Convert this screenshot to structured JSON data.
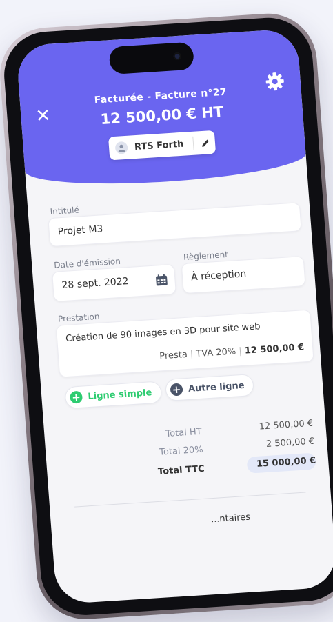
{
  "header": {
    "status_title": "Facturée - Facture n°27",
    "amount": "12 500,00 € HT",
    "client_name": "RTS Forth",
    "accent_color": "#6a65f0"
  },
  "form": {
    "intitule_label": "Intitulé",
    "intitule_value": "Projet M3",
    "date_label": "Date d'émission",
    "date_value": "28 sept. 2022",
    "reglement_label": "Règlement",
    "reglement_value": "À réception",
    "prestation_label": "Prestation",
    "prestation_desc": "Création de 90 images en 3D pour site web",
    "prestation_type": "Presta",
    "prestation_tva": "TVA 20%",
    "prestation_amount": "12 500,00 €"
  },
  "actions": {
    "simple_line": "Ligne simple",
    "other_line": "Autre ligne",
    "simple_color": "#2ecc71",
    "other_color": "#4a5468"
  },
  "totals": {
    "ht_label": "Total HT",
    "ht_value": "12 500,00 €",
    "tva_label": "Total 20%",
    "tva_value": "2 500,00 €",
    "ttc_label": "Total TTC",
    "ttc_value": "15 000,00 €"
  },
  "footer": {
    "comments_label": "...ntaires"
  },
  "icons": [
    "close-icon",
    "gear-icon",
    "user-icon",
    "pencil-icon",
    "calendar-icon",
    "plus-icon"
  ]
}
